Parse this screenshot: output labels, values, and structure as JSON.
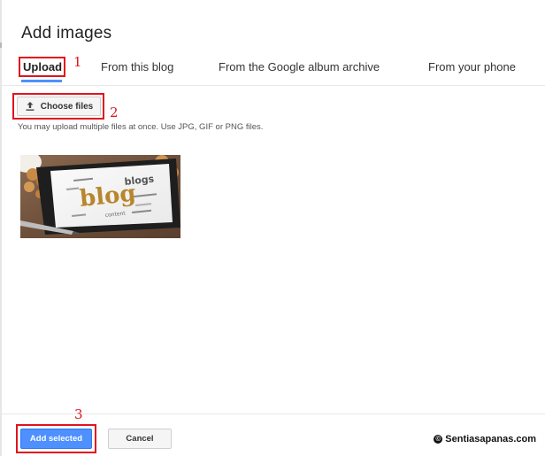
{
  "dialog": {
    "title": "Add images"
  },
  "tabs": [
    {
      "label": "Upload",
      "active": true
    },
    {
      "label": "From this blog",
      "active": false
    },
    {
      "label": "From the Google album archive",
      "active": false
    },
    {
      "label": "From your phone",
      "active": false
    }
  ],
  "upload": {
    "choose_files_label": "Choose files",
    "hint": "You may upload multiple files at once. Use JPG, GIF or PNG files."
  },
  "thumbnail": {
    "word_large": "blog",
    "word_small": "blogs",
    "word_extra": "content"
  },
  "footer": {
    "add_selected_label": "Add selected",
    "cancel_label": "Cancel"
  },
  "annotations": {
    "step1": "1",
    "step2": "2",
    "step3": "3"
  },
  "watermark": {
    "copyright_symbol": "©",
    "text": "Sentiasapanas.com"
  },
  "colors": {
    "accent_blue": "#4d90fe",
    "annotation_red": "#e0141e"
  }
}
